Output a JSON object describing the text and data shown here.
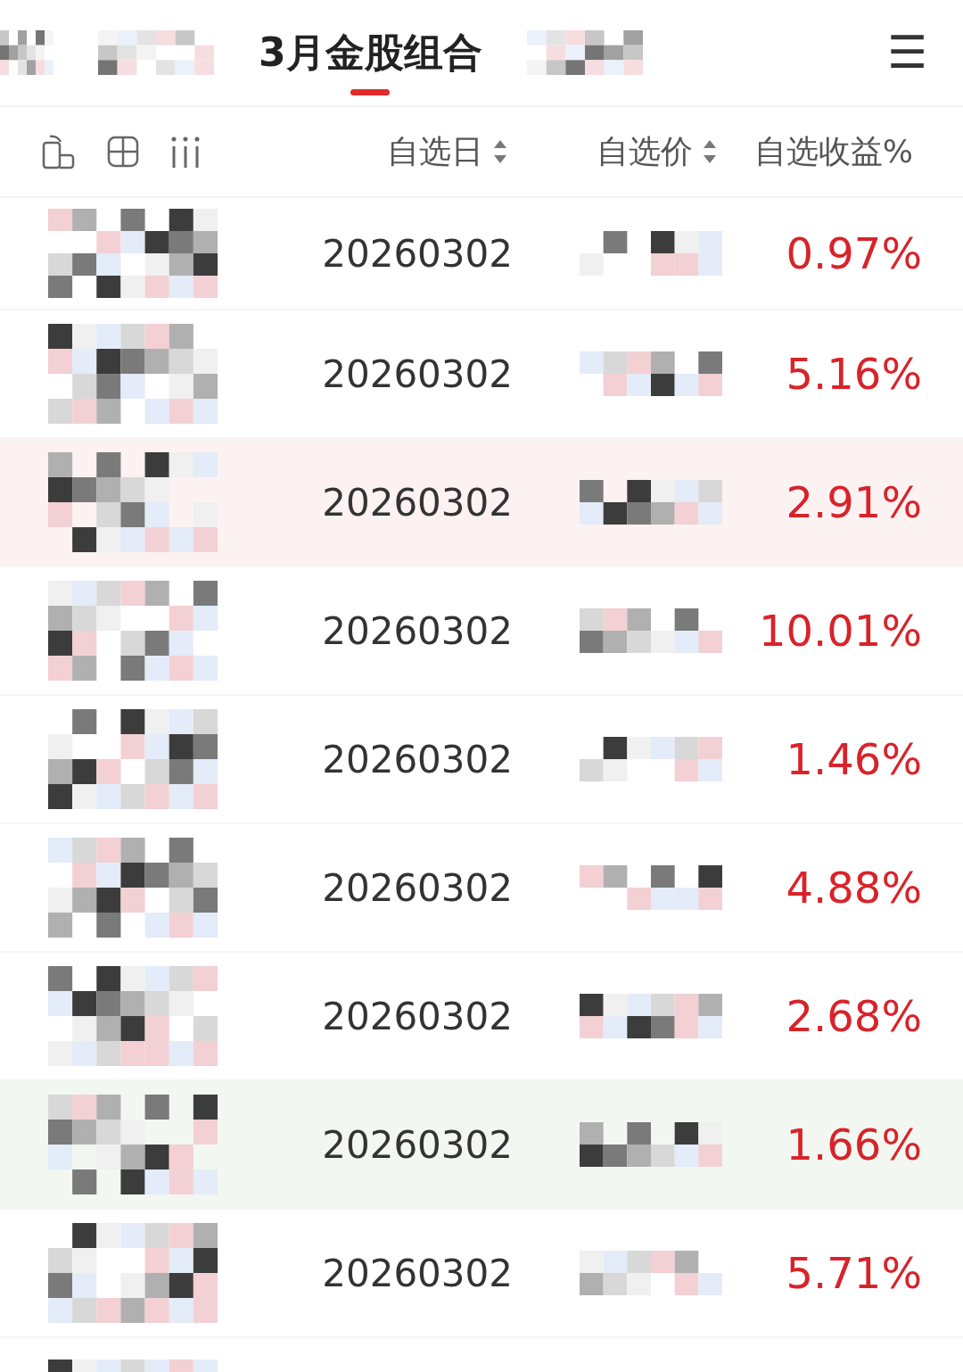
{
  "tabs": [
    {
      "kind": "mosaic",
      "selected": false
    },
    {
      "kind": "mosaic",
      "selected": false
    },
    {
      "kind": "text",
      "label": "3月金股组合",
      "selected": true
    },
    {
      "kind": "mosaic",
      "selected": false
    }
  ],
  "menu_icon": "☰",
  "columns": [
    {
      "label": "自选日",
      "sortable": true
    },
    {
      "label": "自选价",
      "sortable": true
    },
    {
      "label": "自选收益%",
      "sortable": false
    }
  ],
  "rows": [
    {
      "name_cell": {
        "kind": "mosaic"
      },
      "date": "20260302",
      "price_cell": {
        "kind": "mosaic"
      },
      "return": "0.97%",
      "color": "#ffffff"
    },
    {
      "name_cell": {
        "kind": "mosaic"
      },
      "date": "20260302",
      "price_cell": {
        "kind": "mosaic"
      },
      "return": "5.16%",
      "color": "#ffffff"
    },
    {
      "name_cell": {
        "kind": "mosaic"
      },
      "date": "20260302",
      "price_cell": {
        "kind": "mosaic"
      },
      "return": "2.91%",
      "color": "#fdf2f2"
    },
    {
      "name_cell": {
        "kind": "mosaic"
      },
      "date": "20260302",
      "price_cell": {
        "kind": "mosaic"
      },
      "return": "10.01%",
      "color": "#ffffff"
    },
    {
      "name_cell": {
        "kind": "mosaic"
      },
      "date": "20260302",
      "price_cell": {
        "kind": "mosaic"
      },
      "return": "1.46%",
      "color": "#ffffff"
    },
    {
      "name_cell": {
        "kind": "mosaic"
      },
      "date": "20260302",
      "price_cell": {
        "kind": "mosaic"
      },
      "return": "4.88%",
      "color": "#ffffff"
    },
    {
      "name_cell": {
        "kind": "mosaic"
      },
      "date": "20260302",
      "price_cell": {
        "kind": "mosaic"
      },
      "return": "2.68%",
      "color": "#ffffff"
    },
    {
      "name_cell": {
        "kind": "mosaic"
      },
      "date": "20260302",
      "price_cell": {
        "kind": "mosaic"
      },
      "return": "1.66%",
      "color": "#f2f8f1"
    },
    {
      "name_cell": {
        "kind": "mosaic"
      },
      "date": "20260302",
      "price_cell": {
        "kind": "mosaic"
      },
      "return": "5.71%",
      "color": "#ffffff"
    }
  ],
  "cut_off_row": {
    "kind": "mosaic"
  }
}
